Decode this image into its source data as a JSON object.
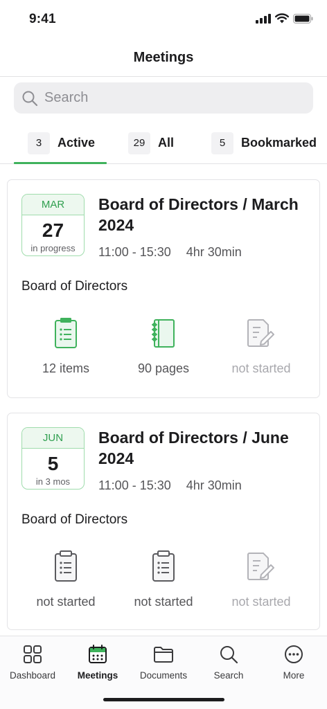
{
  "status_bar": {
    "time": "9:41"
  },
  "header": {
    "title": "Meetings"
  },
  "search": {
    "placeholder": "Search",
    "value": ""
  },
  "tabs": [
    {
      "count": "3",
      "label": "Active"
    },
    {
      "count": "29",
      "label": "All"
    },
    {
      "count": "5",
      "label": "Bookmarked"
    }
  ],
  "meetings": [
    {
      "month": "MAR",
      "day": "27",
      "status": "in progress",
      "title": "Board of Directors / March 2024",
      "time": "11:00 - 15:30",
      "duration": "4hr 30min",
      "group": "Board of Directors",
      "agenda": "12 items",
      "documents": "90 pages",
      "minutes": "not started"
    },
    {
      "month": "JUN",
      "day": "5",
      "status": "in 3 mos",
      "title": "Board of Directors / June 2024",
      "time": "11:00 - 15:30",
      "duration": "4hr 30min",
      "group": "Board of Directors",
      "agenda": "not started",
      "documents": "not started",
      "minutes": "not started"
    }
  ],
  "nav": [
    {
      "label": "Dashboard",
      "icon": "grid-icon"
    },
    {
      "label": "Meetings",
      "icon": "calendar-icon"
    },
    {
      "label": "Documents",
      "icon": "folder-icon"
    },
    {
      "label": "Search",
      "icon": "search-icon"
    },
    {
      "label": "More",
      "icon": "more-icon"
    }
  ],
  "colors": {
    "accent": "#3fb25c",
    "badge_border": "#9fdcac",
    "muted": "#a8a8ad"
  }
}
